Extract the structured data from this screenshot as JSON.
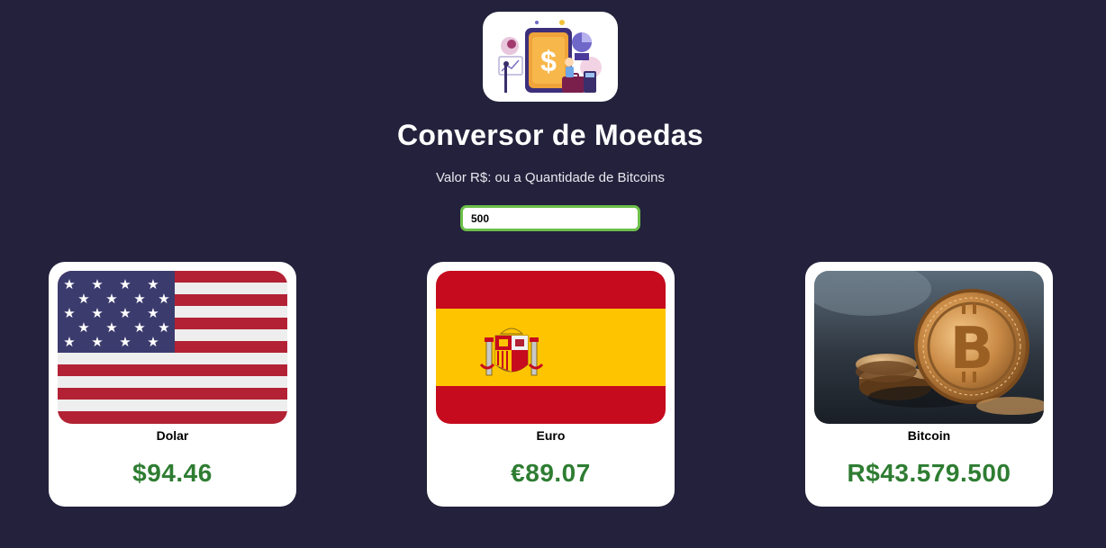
{
  "header": {
    "logo_icon": "currency-converter-illustration",
    "title": "Conversor de Moedas",
    "subtitle": "Valor R$: ou a Quantidade de Bitcoins"
  },
  "input": {
    "value": "500"
  },
  "cards": [
    {
      "label": "Dolar",
      "value": "$94.46",
      "image": "usa-flag"
    },
    {
      "label": "Euro",
      "value": "€89.07",
      "image": "spain-flag"
    },
    {
      "label": "Bitcoin",
      "value": "R$43.579.500",
      "image": "bitcoin-coins-photo"
    }
  ],
  "colors": {
    "background": "#23213b",
    "value_text": "#2e7d32",
    "input_border": "#6cbf4a",
    "card": "#ffffff"
  }
}
